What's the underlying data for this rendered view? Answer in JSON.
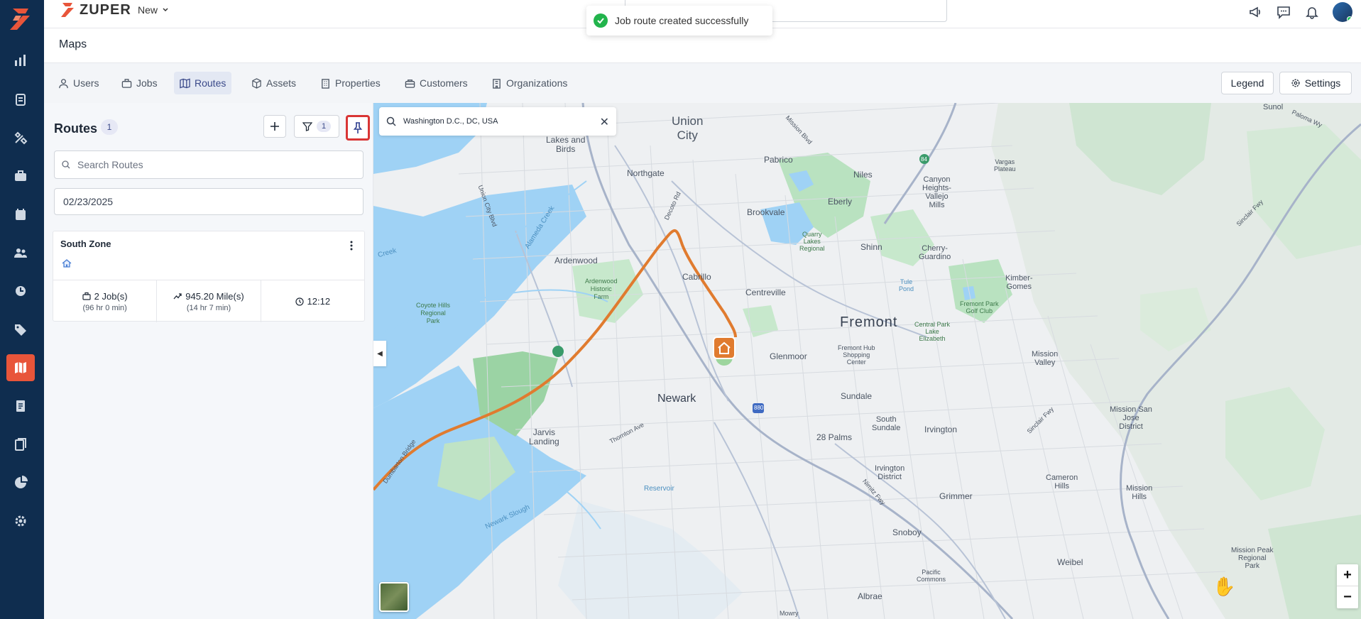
{
  "brand": {
    "name": "ZUPER",
    "new_label": "New"
  },
  "toast": {
    "message": "Job route created successfully"
  },
  "page": {
    "title": "Maps"
  },
  "tabs": [
    {
      "label": "Users",
      "icon": "user-icon"
    },
    {
      "label": "Jobs",
      "icon": "briefcase-icon"
    },
    {
      "label": "Routes",
      "icon": "map-icon",
      "active": true
    },
    {
      "label": "Assets",
      "icon": "box-icon"
    },
    {
      "label": "Properties",
      "icon": "building-icon"
    },
    {
      "label": "Customers",
      "icon": "customers-icon"
    },
    {
      "label": "Organizations",
      "icon": "organization-icon"
    }
  ],
  "toolbar": {
    "legend_label": "Legend",
    "settings_label": "Settings"
  },
  "routes_panel": {
    "title": "Routes",
    "count": "1",
    "filter_count": "1",
    "search_placeholder": "Search Routes",
    "date": "02/23/2025",
    "route": {
      "name": "South Zone",
      "jobs": "2 Job(s)",
      "jobs_sub": "(96 hr 0 min)",
      "miles": "945.20 Mile(s)",
      "miles_sub": "(14 hr 7 min)",
      "time": "12:12"
    }
  },
  "map": {
    "search_value": "Washington D.C., DC, USA",
    "zoom_in": "+",
    "zoom_out": "−",
    "labels": {
      "union_city_1": "Union",
      "union_city_2": "City",
      "lakes_birds_1": "Lakes and",
      "lakes_birds_2": "Birds",
      "pabrico": "Pabrico",
      "northgate": "Northgate",
      "niles": "Niles",
      "eberly": "Eberly",
      "brookvale": "Brookvale",
      "vallejo_1": "Canyon",
      "vallejo_2": "Heights-",
      "vallejo_3": "Vallejo",
      "vallejo_4": "Mills",
      "vargas_1": "Vargas",
      "vargas_2": "Plateau",
      "ardenwood": "Ardenwood",
      "shinn": "Shinn",
      "cherry_1": "Cherry-",
      "cherry_2": "Guardino",
      "kimber_1": "Kimber-",
      "kimber_2": "Gomes",
      "cabrillo": "Cabrillo",
      "centreville": "Centreville",
      "tule_1": "Tule",
      "tule_2": "Pond",
      "fremont": "Fremont",
      "glenmoor": "Glenmoor",
      "newark": "Newark",
      "mission_valley_1": "Mission",
      "mission_valley_2": "Valley",
      "sundale": "Sundale",
      "south_sundale_1": "South",
      "south_sundale_2": "Sundale",
      "irvington": "Irvington",
      "jarvis_1": "Jarvis",
      "jarvis_2": "Landing",
      "palms": "28 Palms",
      "mission_san_jose_1": "Mission San",
      "mission_san_jose_2": "Jose",
      "mission_san_jose_3": "District",
      "irvington_district_1": "Irvington",
      "irvington_district_2": "District",
      "cameron_1": "Cameron",
      "cameron_2": "Hills",
      "mission_hills_1": "Mission",
      "mission_hills_2": "Hills",
      "grimmer": "Grimmer",
      "reservoir": "Reservoir",
      "snoboy": "Snoboy",
      "weibel": "Weibel",
      "albrae": "Albrae",
      "mission_peak_1": "Mission Peak",
      "mission_peak_2": "Regional",
      "mission_peak_3": "Park",
      "newark_slough": "Newark Slough",
      "alameda_creek": "Alameda Creek",
      "dry_creek": "Creek",
      "coyote_1": "Coyote Hills",
      "coyote_2": "Regional",
      "coyote_3": "Park",
      "ardenwood_farm_1": "Ardenwood",
      "ardenwood_farm_2": "Historic",
      "ardenwood_farm_3": "Farm",
      "quarry_1": "Quarry",
      "quarry_2": "Lakes",
      "quarry_3": "Regional",
      "golf_1": "Fremont Park",
      "golf_2": "Golf Club",
      "lake_elizabeth_1": "Central Park",
      "lake_elizabeth_2": "Lake",
      "lake_elizabeth_3": "Elizabeth",
      "hub_1": "Fremont Hub",
      "hub_2": "Shopping",
      "hub_3": "Center",
      "thornton": "Thornton Ave",
      "decoto": "Decoto Rd",
      "mission_blvd": "Mission Blvd",
      "sinclair_1": "Sinclair Fwy",
      "sinclair_2": "Sinclair Fwy",
      "nimitz_1": "Nimitz Fwy",
      "paloma": "Paloma Wy",
      "sunol": "Sunol",
      "union_city_blvd": "Union City Blvd",
      "dumbarton": "Dumbarton Bridge",
      "mowry": "Mowry",
      "pacific_1": "Pacific",
      "pacific_2": "Commons",
      "i880": "880",
      "i84": "84"
    }
  }
}
